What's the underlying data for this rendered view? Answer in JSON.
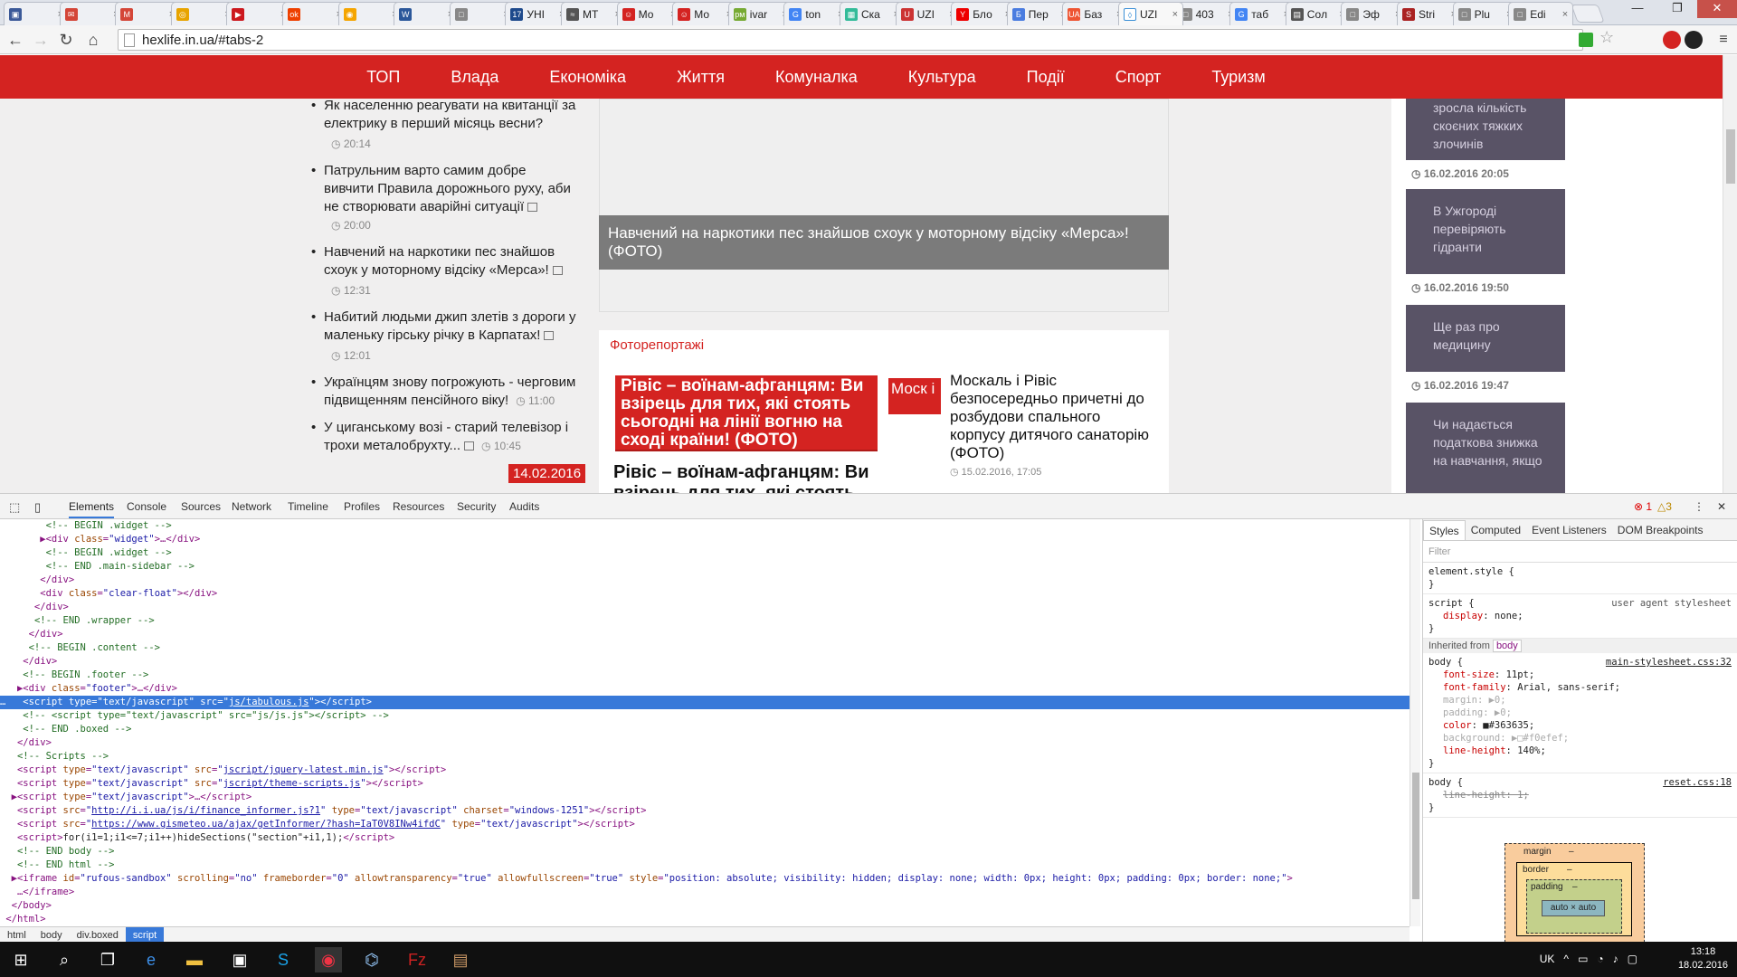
{
  "browser": {
    "tabs": [
      {
        "label": "",
        "color": "#3b5998",
        "glyph": "▣"
      },
      {
        "label": "",
        "color": "#d44638",
        "glyph": "✉"
      },
      {
        "label": "",
        "color": "#d44638",
        "glyph": "M"
      },
      {
        "label": "",
        "color": "#e8a400",
        "glyph": "◎"
      },
      {
        "label": "",
        "color": "#cc181e",
        "glyph": "▶"
      },
      {
        "label": "",
        "color": "#ee4000",
        "glyph": "ok"
      },
      {
        "label": "",
        "color": "#f5a500",
        "glyph": "◉"
      },
      {
        "label": "",
        "color": "#2b579a",
        "glyph": "W"
      },
      {
        "label": "",
        "color": "#888",
        "glyph": "□"
      },
      {
        "label": "УНІ",
        "color": "#1e4a8c",
        "glyph": "17"
      },
      {
        "label": "МТ",
        "color": "#555",
        "glyph": "≈"
      },
      {
        "label": "Мо",
        "color": "#d42321",
        "glyph": "☺"
      },
      {
        "label": "Мо",
        "color": "#d42321",
        "glyph": "☺"
      },
      {
        "label": "ivar",
        "color": "#7a3",
        "glyph": "рм"
      },
      {
        "label": "ton",
        "color": "#4285f4",
        "glyph": "G"
      },
      {
        "label": "Ска",
        "color": "#3b9",
        "glyph": "▦"
      },
      {
        "label": "UZI",
        "color": "#c33",
        "glyph": "U"
      },
      {
        "label": "Бло",
        "color": "#e00",
        "glyph": "Y"
      },
      {
        "label": "Пер",
        "color": "#4a7ce0",
        "glyph": "Б"
      },
      {
        "label": "Баз",
        "color": "#e53",
        "glyph": "UA"
      },
      {
        "label": "UZI",
        "color": "#fff",
        "glyph": "◊"
      },
      {
        "label": "403",
        "color": "#888",
        "glyph": "□"
      },
      {
        "label": "таб",
        "color": "#4285f4",
        "glyph": "G"
      },
      {
        "label": "Coл",
        "color": "#555",
        "glyph": "▤"
      },
      {
        "label": "Эф",
        "color": "#888",
        "glyph": "□"
      },
      {
        "label": "Stri",
        "color": "#a22",
        "glyph": "S"
      },
      {
        "label": "Plu",
        "color": "#888",
        "glyph": "□"
      },
      {
        "label": "Edi",
        "color": "#888",
        "glyph": "□"
      }
    ],
    "active_tab_index": 20,
    "window_buttons": [
      "—",
      "❐",
      "✕"
    ],
    "url": "hexlife.in.ua/#tabs-2"
  },
  "site": {
    "nav": [
      "ТОП",
      "Влада",
      "Економіка",
      "Життя",
      "Комуналка",
      "Культура",
      "Події",
      "Спорт",
      "Туризм"
    ],
    "news": [
      {
        "title": "Як населенню реагувати на квитанції за електрику в перший місяць весни?",
        "time": "20:14",
        "photo": false,
        "time_newline": true
      },
      {
        "title": "Патрульним варто самим добре вивчити Правила дорожнього руху, аби не створювати аварійні ситуації",
        "time": "20:00",
        "photo": true,
        "time_newline": false
      },
      {
        "title": "Навчений на наркотики пес знайшов схоук у моторному відсіку «Мерса»!",
        "time": "12:31",
        "photo": true,
        "time_newline": true
      },
      {
        "title": "Набитий людьми джип злетів з дороги у маленьку гірську річку в Карпатах!",
        "time": "12:01",
        "photo": true,
        "time_newline": true
      },
      {
        "title": "Українцям знову погрожують - черговим підвищенням пенсійного віку!",
        "time": "11:00",
        "photo": false,
        "time_newline": false
      },
      {
        "title": "У циганському возі - старий телевізор і трохи металобрухту...",
        "time": "10:45",
        "photo": true,
        "time_newline": false
      }
    ],
    "date_badge": "14.02.2016",
    "feature_caption": "Навчений на наркотики пес знайшов схоук у моторному відсіку «Мерса»! (ФОТО)",
    "photo_section": {
      "heading": "Фоторепортажі",
      "item1_alt": "Рівіс – воїнам-афганцям: Ви взірець для тих, які стоять сьогодні на лінії вогню на сході країни! (ФОТО)",
      "item1_title": "Рівіс – воїнам-афганцям: Ви взірець для тих, які стоять",
      "item2_alt": "Моск і",
      "item2_title": "Москаль і Рівіс безпосередньо причетні до розбудови спального корпусу дитячого санаторію (ФОТО)",
      "item2_date": "15.02.2016, 17:05"
    },
    "sidebar": [
      {
        "text": "зросла кількість скоєних тяжких злочинів",
        "date": "16.02.2016 20:05"
      },
      {
        "text": "В Ужгороді перевіряють гідранти",
        "date": "16.02.2016 19:50"
      },
      {
        "text": "Ще раз про медицину",
        "date": "16.02.2016 19:47"
      },
      {
        "text": "Чи надається податкова знижка на навчання, якщо",
        "date": ""
      }
    ]
  },
  "devtools": {
    "tabs": [
      "Elements",
      "Console",
      "Sources",
      "Network",
      "Timeline",
      "Profiles",
      "Resources",
      "Security",
      "Audits"
    ],
    "errors": "1",
    "warnings": "3",
    "breadcrumbs": [
      "html",
      "body",
      "div.boxed",
      "script"
    ],
    "styles_tabs": [
      "Styles",
      "Computed",
      "Event Listeners",
      "DOM Breakpoints"
    ],
    "filter_placeholder": "Filter",
    "element_style": "element.style {",
    "ua_rule": {
      "selector": "script {",
      "prop": "display",
      "value": "none;",
      "source": "user agent stylesheet"
    },
    "inherited_label": "Inherited from",
    "inherited_tag": "body",
    "body_rule": {
      "source": "main-stylesheet.css:32",
      "props": [
        {
          "n": "font-size",
          "v": "11pt;",
          "dim": false
        },
        {
          "n": "font-family",
          "v": "Arial, sans-serif;",
          "dim": false
        },
        {
          "n": "margin",
          "v": "▶0;",
          "dim": true
        },
        {
          "n": "padding",
          "v": "▶0;",
          "dim": true
        },
        {
          "n": "color",
          "v": "■#363635;",
          "dim": false
        },
        {
          "n": "background",
          "v": "▶□#f0efef;",
          "dim": true
        },
        {
          "n": "line-height",
          "v": "140%;",
          "dim": false
        }
      ]
    },
    "reset_rule": {
      "source": "reset.css:18",
      "prop": "line-height: 1;"
    },
    "boxmodel": {
      "margin": "margin",
      "border": "border",
      "padding": "padding",
      "content": "auto × auto",
      "dash": "–"
    }
  },
  "taskbar": {
    "lang": "UK",
    "time": "13:18",
    "date": "18.02.2016"
  }
}
